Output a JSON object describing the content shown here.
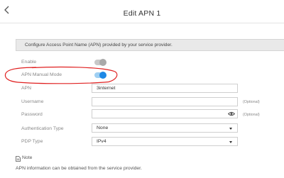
{
  "header": {
    "title": "Edit APN 1",
    "back_icon": "chevron-left-icon"
  },
  "description": "Configure Access Point Name (APN) provided by your service provider.",
  "form": {
    "enable": {
      "label": "Enable",
      "state": "off"
    },
    "apn_manual_mode": {
      "label": "APN Manual Mode",
      "state": "on"
    },
    "apn": {
      "label": "APN",
      "value": "3internet"
    },
    "username": {
      "label": "Username",
      "value": "",
      "optional": "(Optional)"
    },
    "password": {
      "label": "Password",
      "value": "",
      "optional": "(Optional)",
      "icon": "eye-icon"
    },
    "authentication_type": {
      "label": "Authentication Type",
      "selected": "None"
    },
    "pdp_type": {
      "label": "PDP Type",
      "selected": "IPv4"
    }
  },
  "note": {
    "title": "Note",
    "text": "APN information can be obtained from the service provider.",
    "icon": "note-icon"
  },
  "colors": {
    "toggle_on": "#1e88e5",
    "toggle_off": "#a9a9a9",
    "annotation": "#e02020"
  }
}
